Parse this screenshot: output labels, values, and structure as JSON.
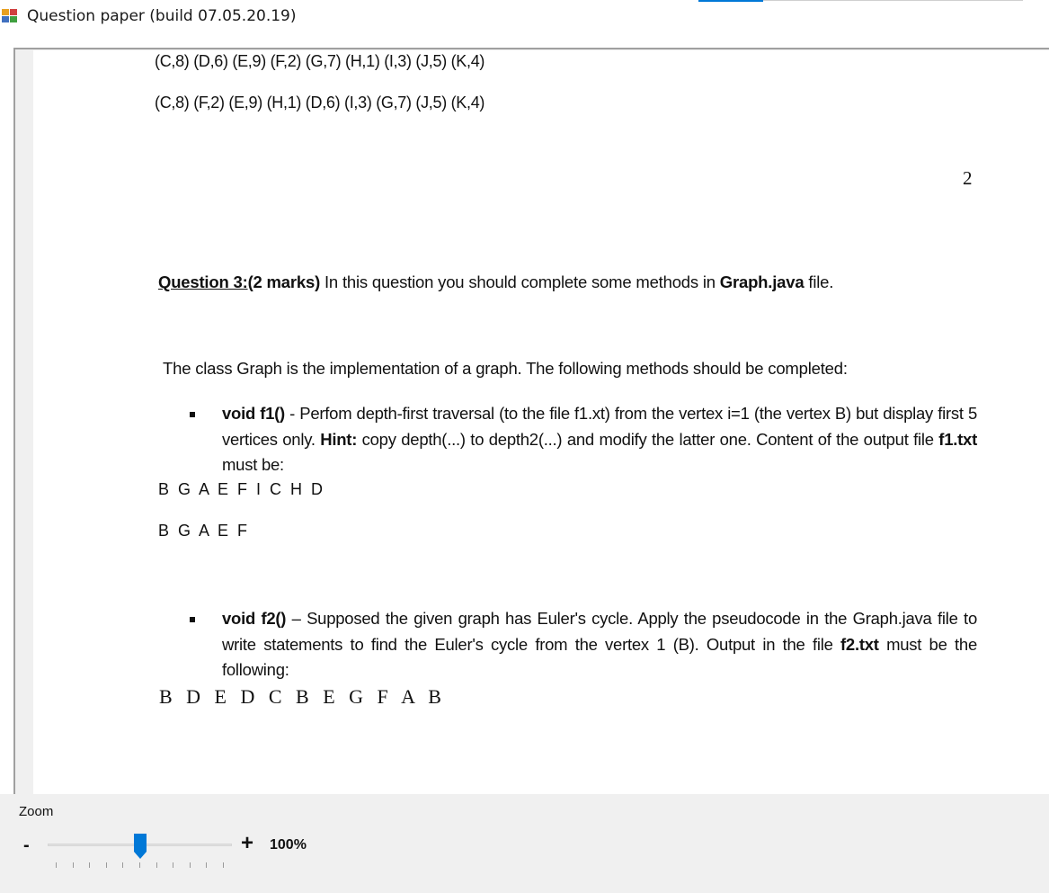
{
  "window": {
    "title": "Question paper (build 07.05.20.19)",
    "accent_color": "#0078d7"
  },
  "document": {
    "pairs_line_1": "(C,8) (D,6) (E,9) (F,2) (G,7) (H,1) (I,3) (J,5) (K,4)",
    "pairs_line_2": "(C,8) (F,2) (E,9) (H,1) (D,6) (I,3) (G,7) (J,5) (K,4)",
    "page_number": "2",
    "question3": {
      "heading": "Question 3:",
      "marks": "(2 marks)",
      "text_before": " In this question you should complete some methods in ",
      "filename": "Graph.java",
      "text_after": " file."
    },
    "intro": "The class Graph is the implementation of a graph. The following methods should be completed:",
    "f1": {
      "signature": "void f1()",
      "text_1": " - Perfom depth-first traversal (to the file f1.xt) from the vertex  i=1 (the vertex B) but display first 5 vertices only. ",
      "hint_label": "Hint:",
      "text_2": " copy depth(...) to depth2(...) and modify the latter one. Content of  the output file ",
      "output_file": "f1.txt",
      "text_3": " must be:",
      "output_line_1": "B G A E F I C H D",
      "output_line_2": "B G A E F"
    },
    "f2": {
      "signature": "void f2()",
      "text_1": " – Supposed the given graph has Euler's cycle. Apply the pseudocode in the Graph.java file to write statements to find the Euler's cycle from the vertex 1 (B). Output in the file ",
      "output_file": "f2.txt",
      "text_2": " must be the following:",
      "output_line": "B D E D C B E G F A B"
    }
  },
  "zoom": {
    "label": "Zoom",
    "minus_label": "-",
    "plus_label": "+",
    "value_text": "100%",
    "slider_position_fraction": 0.5,
    "thumb_color": "#0078d7"
  }
}
